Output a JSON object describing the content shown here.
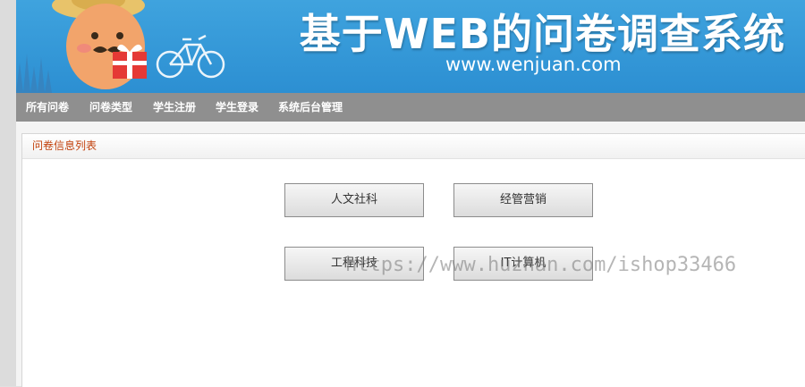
{
  "banner": {
    "title": "基于WEB的问卷调查系统",
    "url": "www.wenjuan.com"
  },
  "nav": {
    "items": [
      "所有问卷",
      "问卷类型",
      "学生注册",
      "学生登录",
      "系统后台管理"
    ]
  },
  "panel": {
    "title": "问卷信息列表"
  },
  "categories": [
    "人文社科",
    "经管营销",
    "工程科技",
    "IT计算机"
  ],
  "watermark": "https://www.huzhan.com/ishop33466",
  "colors": {
    "banner_blue": "#2c8fd2",
    "nav_gray": "#8f8f8f",
    "panel_title": "#c2410c"
  }
}
